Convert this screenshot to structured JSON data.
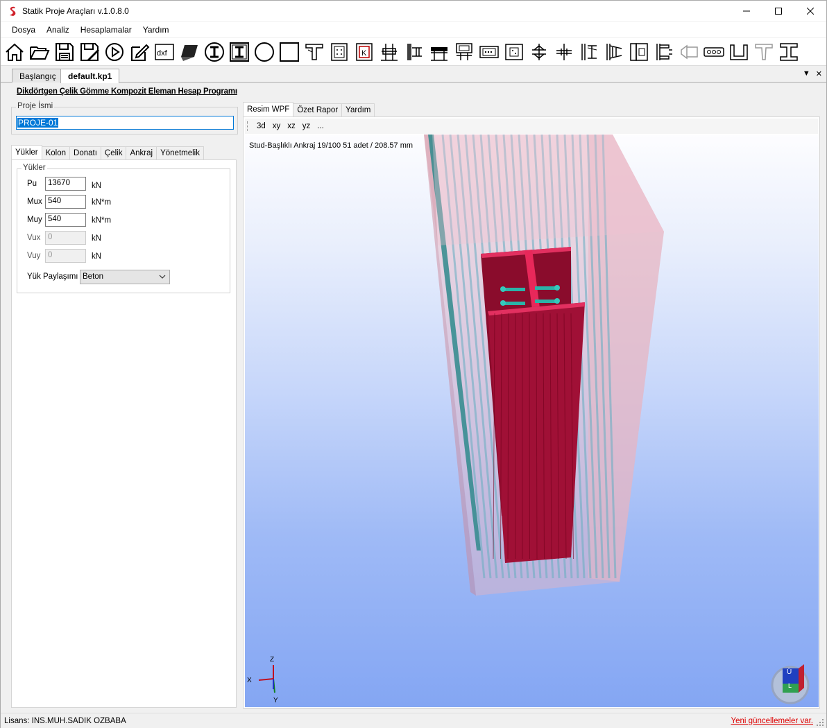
{
  "window": {
    "title": "Statik Proje Araçları v.1.0.8.0"
  },
  "menu": [
    "Dosya",
    "Analiz",
    "Hesaplamalar",
    "Yardım"
  ],
  "toolbar_icons": [
    "home-icon",
    "open-folder-icon",
    "save-icon",
    "save-as-icon",
    "run-icon",
    "edit-icon",
    "dxf-export-icon",
    "3d-view-icon",
    "i-section-circle-icon",
    "i-section-box-icon",
    "circle-section-icon",
    "square-section-icon",
    "t-section-icon",
    "column-plate-icon",
    "k-plate-icon",
    "beam-column-icon",
    "beam-side-icon",
    "moment-connection-icon",
    "flange-connection-icon",
    "splice-icon",
    "bolt-group-icon",
    "column-splice-icon",
    "beam-splice-icon",
    "end-plate-icon",
    "stiffener-icon",
    "base-plate-icon",
    "gusset-icon",
    "weld-icon",
    "bracket-icon",
    "bolt-row-icon",
    "u-channel-icon",
    "tee-icon",
    "i-beam-icon"
  ],
  "doc_tabs": [
    "Başlangıç",
    "default.kp1"
  ],
  "app_title": "Dikdörtgen Çelik Gömme Kompozit Eleman Hesap Programı",
  "project": {
    "legend": "Proje İsmi",
    "name": "PROJE-01"
  },
  "sub_tabs": [
    "Yükler",
    "Kolon",
    "Donatı",
    "Çelik",
    "Ankraj",
    "Yönetmelik"
  ],
  "loads": {
    "legend": "Yükler",
    "fields": [
      {
        "label": "Pu",
        "value": "13670",
        "unit": "kN",
        "enabled": true
      },
      {
        "label": "Mux",
        "value": "540",
        "unit": "kN*m",
        "enabled": true
      },
      {
        "label": "Muy",
        "value": "540",
        "unit": "kN*m",
        "enabled": true
      },
      {
        "label": "Vux",
        "value": "0",
        "unit": "kN",
        "enabled": false
      },
      {
        "label": "Vuy",
        "value": "0",
        "unit": "kN",
        "enabled": false
      }
    ],
    "share_label": "Yük Paylaşımı",
    "share_value": "Beton"
  },
  "right_tabs": [
    "Resim WPF",
    "Özet Rapor",
    "Yardım"
  ],
  "view_buttons": [
    "3d",
    "xy",
    "xz",
    "yz",
    "..."
  ],
  "viewport": {
    "info": "Stud-Başlıklı Ankraj 19/100  51 adet / 208.57 mm",
    "axes": {
      "x": "X",
      "y": "Y",
      "z": "Z"
    },
    "cube_labels": {
      "top": "Ü",
      "front": "L"
    }
  },
  "status": {
    "license": "Lisans: INS.MUH.SADIK OZBABA",
    "update": "Yeni güncellemeler var."
  },
  "colors": {
    "steel": "#b0103a",
    "concrete": "#e8b8c4",
    "rebar": "#5aa6b8",
    "stud": "#2bb3a8",
    "link": "#d00000"
  }
}
